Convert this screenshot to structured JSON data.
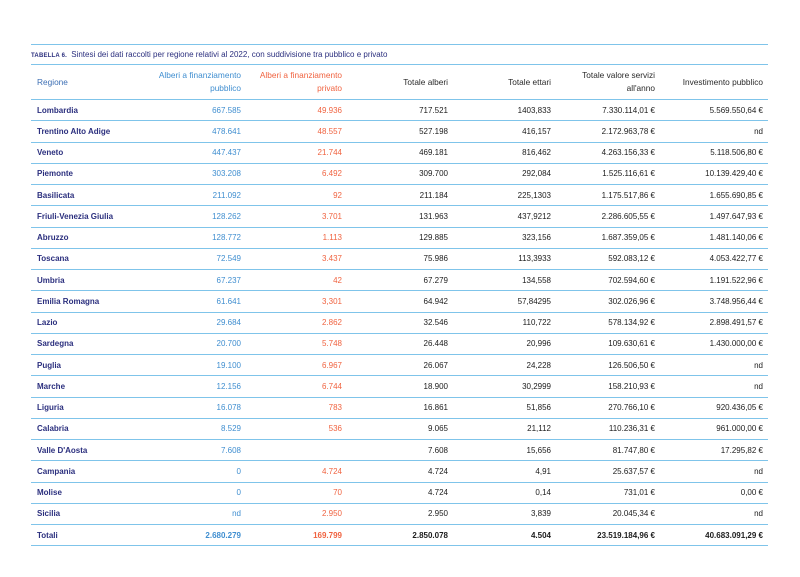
{
  "caption": {
    "number": "TABELLA 6.",
    "title": "Sintesi dei dati raccolti per regione relativi al 2022, con suddivisione tra pubblico e privato"
  },
  "headers": {
    "region": "Regione",
    "public_trees": "Alberi a finanziamento pubblico",
    "private_trees": "Alberi a finanziamento privato",
    "total_trees": "Totale alberi",
    "total_hectares": "Totale ettari",
    "total_services": "Totale valore servizi all'anno",
    "public_investment": "Investimento pubblico"
  },
  "colors": {
    "region_text": "#2b2f7e",
    "public_text": "#3f8ed0",
    "private_text": "#f06340",
    "rule": "#7fc4ea"
  },
  "rows": [
    {
      "region": "Lombardia",
      "public_trees": "667.585",
      "private_trees": "49.936",
      "total_trees": "717.521",
      "total_hectares": "1403,833",
      "total_services": "7.330.114,01 €",
      "public_investment": "5.569.550,64 €"
    },
    {
      "region": "Trentino Alto Adige",
      "public_trees": "478.641",
      "private_trees": "48.557",
      "total_trees": "527.198",
      "total_hectares": "416,157",
      "total_services": "2.172.963,78 €",
      "public_investment": "nd"
    },
    {
      "region": "Veneto",
      "public_trees": "447.437",
      "private_trees": "21.744",
      "total_trees": "469.181",
      "total_hectares": "816,462",
      "total_services": "4.263.156,33 €",
      "public_investment": "5.118.506,80 €"
    },
    {
      "region": "Piemonte",
      "public_trees": "303.208",
      "private_trees": "6.492",
      "total_trees": "309.700",
      "total_hectares": "292,084",
      "total_services": "1.525.116,61 €",
      "public_investment": "10.139.429,40 €"
    },
    {
      "region": "Basilicata",
      "public_trees": "211.092",
      "private_trees": "92",
      "total_trees": "211.184",
      "total_hectares": "225,1303",
      "total_services": "1.175.517,86 €",
      "public_investment": "1.655.690,85 €"
    },
    {
      "region": "Friuli-Venezia Giulia",
      "public_trees": "128.262",
      "private_trees": "3.701",
      "total_trees": "131.963",
      "total_hectares": "437,9212",
      "total_services": "2.286.605,55 €",
      "public_investment": "1.497.647,93 €"
    },
    {
      "region": "Abruzzo",
      "public_trees": "128.772",
      "private_trees": "1.113",
      "total_trees": "129.885",
      "total_hectares": "323,156",
      "total_services": "1.687.359,05 €",
      "public_investment": "1.481.140,06 €"
    },
    {
      "region": "Toscana",
      "public_trees": "72.549",
      "private_trees": "3.437",
      "total_trees": "75.986",
      "total_hectares": "113,3933",
      "total_services": "592.083,12 €",
      "public_investment": "4.053.422,77 €"
    },
    {
      "region": "Umbria",
      "public_trees": "67.237",
      "private_trees": "42",
      "total_trees": "67.279",
      "total_hectares": "134,558",
      "total_services": "702.594,60 €",
      "public_investment": "1.191.522,96 €"
    },
    {
      "region": "Emilia Romagna",
      "public_trees": "61.641",
      "private_trees": "3,301",
      "total_trees": "64.942",
      "total_hectares": "57,84295",
      "total_services": "302.026,96 €",
      "public_investment": "3.748.956,44 €"
    },
    {
      "region": "Lazio",
      "public_trees": "29.684",
      "private_trees": "2.862",
      "total_trees": "32.546",
      "total_hectares": "110,722",
      "total_services": "578.134,92 €",
      "public_investment": "2.898.491,57 €"
    },
    {
      "region": "Sardegna",
      "public_trees": "20.700",
      "private_trees": "5.748",
      "total_trees": "26.448",
      "total_hectares": "20,996",
      "total_services": "109.630,61 €",
      "public_investment": "1.430.000,00 €"
    },
    {
      "region": "Puglia",
      "public_trees": "19.100",
      "private_trees": "6.967",
      "total_trees": "26.067",
      "total_hectares": "24,228",
      "total_services": "126.506,50 €",
      "public_investment": "nd"
    },
    {
      "region": "Marche",
      "public_trees": "12.156",
      "private_trees": "6.744",
      "total_trees": "18.900",
      "total_hectares": "30,2999",
      "total_services": "158.210,93 €",
      "public_investment": "nd"
    },
    {
      "region": "Liguria",
      "public_trees": "16.078",
      "private_trees": "783",
      "total_trees": "16.861",
      "total_hectares": "51,856",
      "total_services": "270.766,10 €",
      "public_investment": "920.436,05 €"
    },
    {
      "region": "Calabria",
      "public_trees": "8.529",
      "private_trees": "536",
      "total_trees": "9.065",
      "total_hectares": "21,112",
      "total_services": "110.236,31 €",
      "public_investment": "961.000,00 €"
    },
    {
      "region": "Valle D'Aosta",
      "public_trees": "7.608",
      "private_trees": "",
      "total_trees": "7.608",
      "total_hectares": "15,656",
      "total_services": "81.747,80 €",
      "public_investment": "17.295,82 €"
    },
    {
      "region": "Campania",
      "public_trees": "0",
      "private_trees": "4.724",
      "total_trees": "4.724",
      "total_hectares": "4,91",
      "total_services": "25.637,57 €",
      "public_investment": "nd"
    },
    {
      "region": "Molise",
      "public_trees": "0",
      "private_trees": "70",
      "total_trees": "4.724",
      "total_hectares": "0,14",
      "total_services": "731,01 €",
      "public_investment": "0,00 €"
    },
    {
      "region": "Sicilia",
      "public_trees": "nd",
      "private_trees": "2.950",
      "total_trees": "2.950",
      "total_hectares": "3,839",
      "total_services": "20.045,34 €",
      "public_investment": "nd"
    }
  ],
  "totals": {
    "region": "Totali",
    "public_trees": "2.680.279",
    "private_trees": "169.799",
    "total_trees": "2.850.078",
    "total_hectares": "4.504",
    "total_services": "23.519.184,96 €",
    "public_investment": "40.683.091,29 €"
  }
}
